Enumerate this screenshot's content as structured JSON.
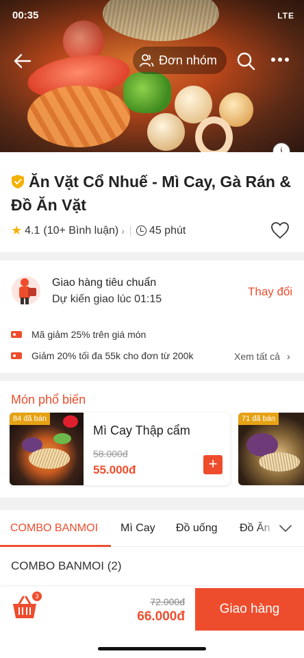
{
  "status_bar": {
    "time": "00:35",
    "network": "LTE"
  },
  "colors": {
    "accent": "#ee4d2d",
    "star": "#f5b000",
    "badge": "#f0aa14"
  },
  "header": {
    "back_icon": "arrow-left-icon",
    "group_order_label": "Đơn nhóm",
    "search_icon": "search-icon",
    "more_icon": "more-dots-icon",
    "info_icon": "info-icon"
  },
  "store": {
    "name": "Ăn Vặt Cổ Nhuế - Mì Cay, Gà Rán & Đồ Ăn Vặt",
    "rating": "4.1",
    "reviews": "(10+ Bình luận)",
    "delivery_time": "45 phút"
  },
  "delivery": {
    "title": "Giao hàng tiêu chuẩn",
    "estimate": "Dự kiến giao lúc 01:15",
    "change_label": "Thay đổi"
  },
  "promotions": [
    {
      "text": "Mã giảm 25% trên giá món"
    },
    {
      "text": "Giảm 20% tối đa 55k cho đơn từ 200k"
    }
  ],
  "promotions_see_all": "Xem tất cả",
  "popular": {
    "title": "Món phổ biến",
    "items": [
      {
        "sold": "84 đã bán",
        "name": "Mì Cay Thập cẩm",
        "old_price": "58.000đ",
        "price": "55.000đ",
        "add_label": "+"
      },
      {
        "sold": "71 đã bán"
      }
    ]
  },
  "tabs": [
    {
      "label": "COMBO BANMOI",
      "active": true
    },
    {
      "label": "Mì Cay",
      "active": false
    },
    {
      "label": "Đồ uống",
      "active": false
    },
    {
      "label": "Đồ Ăn",
      "active": false
    }
  ],
  "section_title": "COMBO BANMOI (2)",
  "cart": {
    "count": "3",
    "old_total": "72.000đ",
    "total": "66.000đ",
    "checkout_label": "Giao hàng"
  }
}
